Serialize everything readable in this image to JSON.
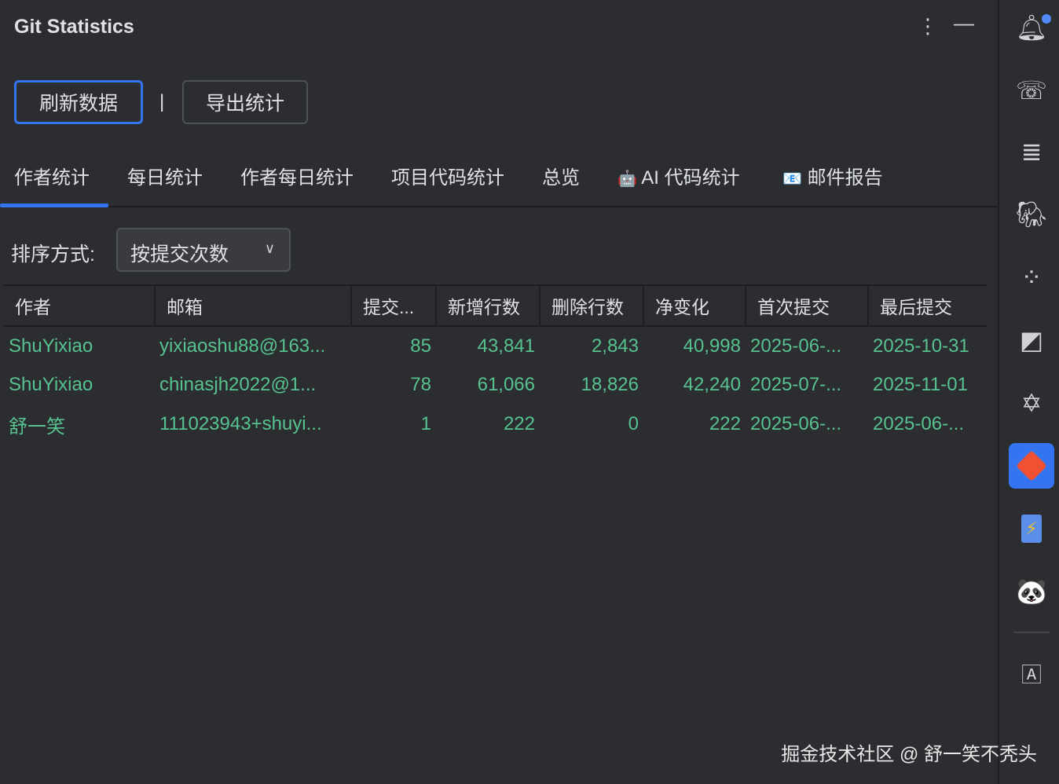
{
  "header": {
    "title": "Git Statistics",
    "more_icon": "more-vertical-icon",
    "minimize_icon": "minimize-icon"
  },
  "toolbar": {
    "refresh": "刷新数据",
    "separator": "|",
    "export": "导出统计"
  },
  "tabs": [
    {
      "label": "作者统计",
      "icon": ""
    },
    {
      "label": "每日统计",
      "icon": ""
    },
    {
      "label": "作者每日统计",
      "icon": ""
    },
    {
      "label": "项目代码统计",
      "icon": ""
    },
    {
      "label": "总览",
      "icon": ""
    },
    {
      "label": "AI 代码统计",
      "icon": "🤖"
    },
    {
      "label": "邮件报告",
      "icon": "📧"
    }
  ],
  "sort": {
    "label": "排序方式:",
    "value": "按提交次数"
  },
  "table": {
    "columns": [
      "作者",
      "邮箱",
      "提交...",
      "新增行数",
      "删除行数",
      "净变化",
      "首次提交",
      "最后提交"
    ],
    "rows": [
      [
        "ShuYixiao",
        "yixiaoshu88@163...",
        "85",
        "43,841",
        "2,843",
        "40,998",
        "2025-06-...",
        "2025-10-31"
      ],
      [
        "ShuYixiao",
        "chinasjh2022@1...",
        "78",
        "61,066",
        "18,826",
        "42,240",
        "2025-07-...",
        "2025-11-01"
      ],
      [
        "舒一笑",
        "111023943+shuyi...",
        "1",
        "222",
        "0",
        "222",
        "2025-06-...",
        "2025-06-..."
      ]
    ]
  },
  "watermark": "掘金技术社区 @ 舒一笑不秃头",
  "colors": {
    "accent": "#3574f0",
    "value": "#57c28f",
    "bg": "#2b2d30"
  }
}
